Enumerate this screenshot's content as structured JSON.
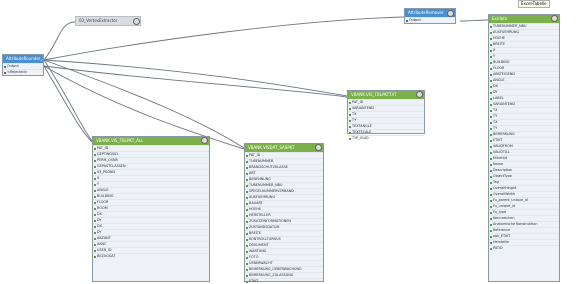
{
  "canvas": {
    "tooltip": "Excel-Tabelle",
    "vertex_extractor": "03_VertexExtractor",
    "attr_source": {
      "title": "AttributeRounder_2",
      "ports": [
        "Output",
        "<Rejected>"
      ]
    },
    "attr_remover": {
      "title": "AttributeRemover",
      "port": "Output"
    },
    "nodes": {
      "vis_all": {
        "title": "VBANK.VIS_TBLPKT_ALL",
        "fields": [
          "PAT_ID",
          "GEPTINGSID",
          "PERM_OSNR",
          "GEPASTCLASSEN",
          "03_PSOND",
          "X",
          "Y",
          "ANGLE",
          "BUILDING",
          "FLOOR",
          "ROOM",
          "DX",
          "DY",
          "DX",
          "DY",
          "AKZANT",
          "AKNC",
          "USER_ID",
          "BEZUGSAT"
        ]
      },
      "vis_dat": {
        "title": "VBANK.VISDAT_SASPKT",
        "fields": [
          "PAT_ID",
          "TUBENUMMER",
          "BRANDSCHUTZKLASSE",
          "ART",
          "BENENNUNG",
          "TUBENUMMER_NBU",
          "SPEGELNUMMERVERBAND",
          "AUSFUEHRUNG",
          "BAUART",
          "HOEHE",
          "HERSTELLER",
          "ZUSATZINFORMATIONEN",
          "ZUSTANDSDATUM",
          "BREITE",
          "KONTROLLTURNUS",
          "DOKUMENT",
          "WARTUNG",
          "FOTO",
          "UEBERWACHT",
          "BEMERKUNG_UEBERWACHUNG",
          "BEMERKUNG_ZULASSUNG",
          "ETIKT"
        ]
      },
      "vis_text": {
        "title": "VBANK.VIS_TBLPKTTXT",
        "fields": [
          "PAT_ID",
          "VARIANTEND",
          "TX",
          "TY",
          "TEXTANGLE",
          "TEXTSCALE",
          "TYP_GUID"
        ]
      },
      "excel": {
        "title": "Ex/data",
        "fields": [
          "TUBENUMMER_NBU",
          "AUSFUEHRUNG",
          "HOEHE",
          "BREITE",
          "X",
          "Y",
          "BUILDING",
          "FLOOR",
          "ABSTEIGEND",
          "ANGLE",
          "DX",
          "DY",
          "LABEL",
          "VARIANTEND",
          "TX",
          "TY",
          "TX",
          "TY",
          "BEMERKUNG",
          "ETIKT",
          "VALIDFROM",
          "VALIDTILL",
          "Etikettid",
          "Name",
          "Description",
          "ObjectType",
          "Tag",
          "OverallHeight",
          "OverallWidth",
          "Fu_parent_unique_id",
          "Fu_unique_id",
          "Fu_type",
          "Kennzeichen",
          "Anatomische Konstruktion",
          "Reference",
          "epk_ETIKT",
          "Hersteller",
          "PATID"
        ]
      }
    }
  }
}
